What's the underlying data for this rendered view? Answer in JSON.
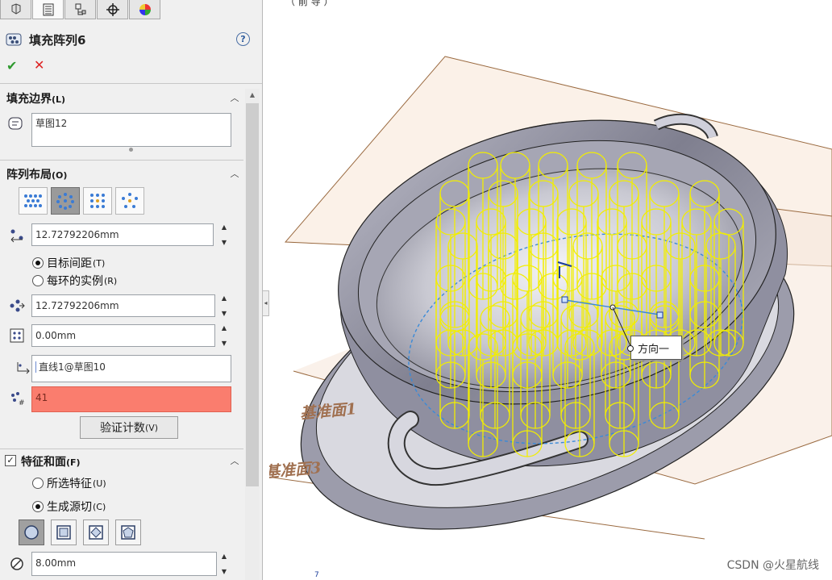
{
  "feature": {
    "title": "填充阵列6",
    "help": "?",
    "ok": "✔",
    "cancel": "✕"
  },
  "tabs": [
    "feature-manager",
    "property-manager",
    "configuration-manager",
    "dimxpert-manager",
    "display-manager"
  ],
  "fill_boundary": {
    "title": "填充边界",
    "key": "(L)",
    "selection": "草图12"
  },
  "pattern_layout": {
    "title": "阵列布局",
    "key": "(O)",
    "layouts": [
      "perforation",
      "circular",
      "square",
      "polygon"
    ],
    "active_layout": "circular",
    "loop_spacing": "12.72792206mm",
    "radio_target_spacing": "目标间距",
    "radio_target_spacing_key": "(T)",
    "radio_instances_per_loop": "每环的实例",
    "radio_instances_per_loop_key": "(R)",
    "selected_radio": "target_spacing",
    "instance_spacing": "12.72792206mm",
    "margin": "0.00mm",
    "direction": "直线1@草图10",
    "instance_count": "41",
    "verify_button": "验证计数",
    "verify_key": "(V)"
  },
  "features_faces": {
    "title": "特征和面",
    "key": "(F)",
    "checked": true,
    "radio_selected_features": "所选特征",
    "radio_selected_features_key": "(U)",
    "radio_create_seed_cut": "生成源切",
    "radio_create_seed_cut_key": "(C)",
    "selected_radio": "seed_cut",
    "shapes": [
      "circle",
      "square",
      "diamond",
      "polygon"
    ],
    "active_shape": "circle",
    "diameter": "8.00mm"
  },
  "viewport": {
    "plane_label_1": "基准面1",
    "plane_label_2": "基准面3",
    "direction_label": "方向一",
    "watermark": "CSDN @火星航线",
    "top_fragment": "（ 前 导 ）",
    "bottom_fragment": "7"
  }
}
